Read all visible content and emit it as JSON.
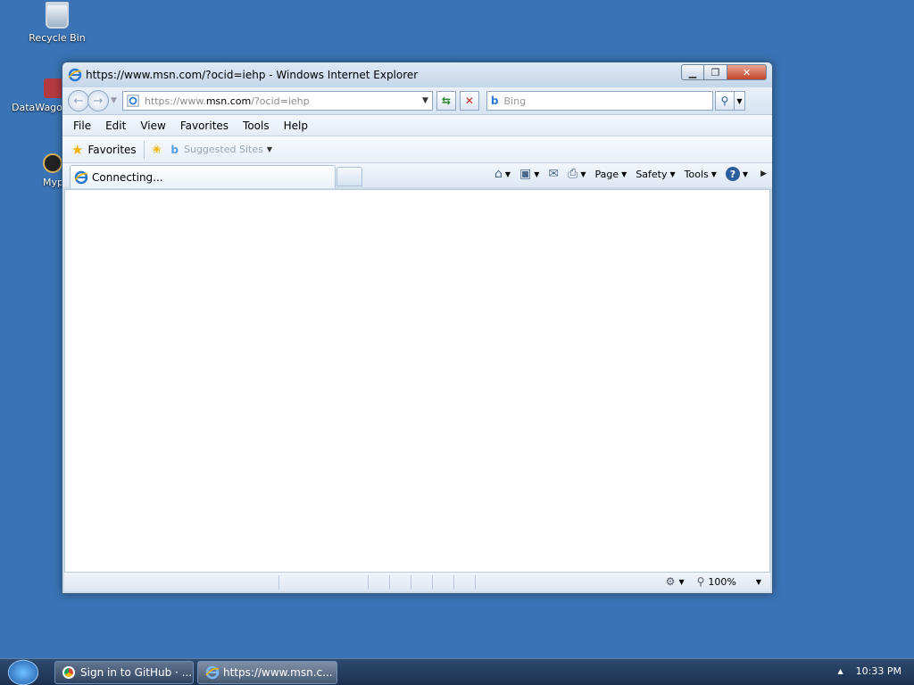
{
  "desktop": {
    "icons": [
      {
        "label": "Recycle Bin"
      },
      {
        "label": "DataWago"
      },
      {
        "label": "Myp"
      }
    ]
  },
  "window": {
    "title": "https://www.msn.com/?ocid=iehp - Windows Internet Explorer",
    "address": {
      "scheme": "https://",
      "www": "www.",
      "host": "msn.com",
      "path": "/?ocid=iehp"
    },
    "search": {
      "placeholder": "Bing"
    },
    "menu": [
      "File",
      "Edit",
      "View",
      "Favorites",
      "Tools",
      "Help"
    ],
    "favorites": {
      "label": "Favorites",
      "suggested": "Suggested Sites"
    },
    "tab": {
      "label": "Connecting..."
    },
    "commands": {
      "page": "Page",
      "safety": "Safety",
      "tools": "Tools"
    },
    "status": {
      "zoom": "100%"
    }
  },
  "taskbar": {
    "tasks": [
      {
        "label": "Sign in to GitHub · ..."
      },
      {
        "label": "https://www.msn.c..."
      }
    ],
    "clock": "10:33 PM"
  },
  "colors": {
    "desktop": "#3a74b6",
    "taskbar": "#1c3150"
  }
}
